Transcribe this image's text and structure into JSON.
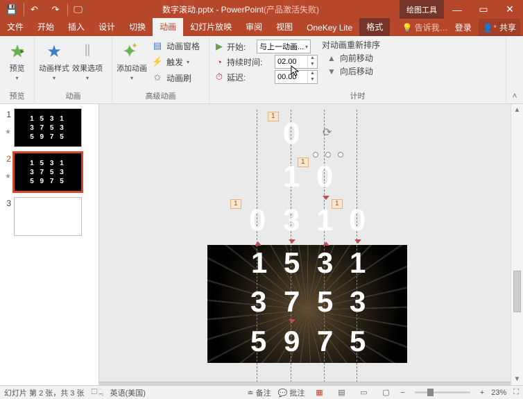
{
  "titlebar": {
    "doc_name": "数字滚动.pptx - PowerPoint",
    "deactivated": "(产品激活失败)",
    "context_tool": "绘图工具"
  },
  "qat": {
    "save": "💾",
    "undo": "↶",
    "redo": "↷",
    "start": "🖵"
  },
  "tabs": {
    "file": "文件",
    "home": "开始",
    "insert": "插入",
    "design": "设计",
    "transitions": "切换",
    "animations": "动画",
    "slideshow": "幻灯片放映",
    "review": "审阅",
    "view": "视图",
    "onekey": "OneKey Lite",
    "format": "格式",
    "tell_placeholder": "告诉我…",
    "login": "登录",
    "share": "共享"
  },
  "ribbon": {
    "preview": {
      "label": "预览",
      "group": "预览"
    },
    "anim": {
      "styles": "动画样式",
      "effect_opts": "效果选项",
      "group": "动画"
    },
    "add": {
      "add_anim": "添加动画",
      "pane": "动画窗格",
      "trigger": "触发 ",
      "painter": "动画刷",
      "group": "高级动画"
    },
    "timing": {
      "start_label": "开始:",
      "start_value": "与上一动画...",
      "duration_label": "持续时间:",
      "duration_value": "02.00",
      "delay_label": "延迟:",
      "delay_value": "00.00",
      "reorder": "对动画重新排序",
      "forward": "向前移动",
      "backward": "向后移动",
      "group": "计时"
    }
  },
  "thumbs": {
    "s1": {
      "n": "1",
      "line1": "1 5 3 1",
      "line2": "3 7 5 3",
      "line3": "5 9 7 5"
    },
    "s2": {
      "n": "2",
      "line1": "1 5 3 1",
      "line2": "3 7 5 3",
      "line3": "5 9 7 5"
    },
    "s3": {
      "n": "3"
    }
  },
  "canvas": {
    "tags": {
      "t1": "1",
      "t2": "1",
      "t3": "1",
      "t4": "1"
    },
    "digits": {
      "c_top": "0",
      "c_r2l": "1",
      "c_r2r": "0",
      "row3": [
        "0",
        "3",
        "1",
        "0"
      ],
      "row4": [
        "1",
        "5",
        "3",
        "1"
      ],
      "row5": [
        "3",
        "7",
        "5",
        "3"
      ],
      "row6": [
        "5",
        "9",
        "7",
        "5"
      ]
    }
  },
  "status": {
    "slide_info": "幻灯片 第 2 张，共 3 张",
    "lang": "英语(美国)",
    "notes": "备注",
    "comments": "批注",
    "zoom": "23%",
    "minus": "−",
    "plus": "+"
  }
}
